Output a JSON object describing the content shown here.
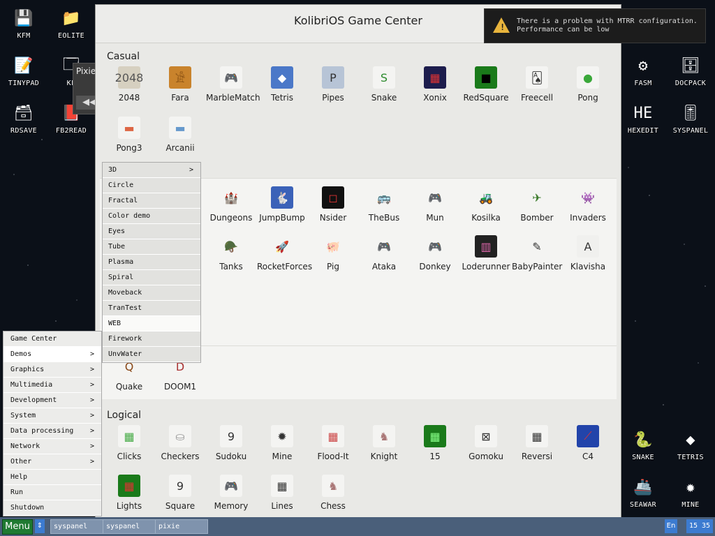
{
  "desktop": {
    "left_icons": [
      {
        "label": "KFM",
        "icon": "floppy-disk-icon",
        "glyph": "💾"
      },
      {
        "label": "EOLITE",
        "icon": "folder-icon",
        "glyph": "📁"
      },
      {
        "label": "TINYPAD",
        "icon": "notepad-icon",
        "glyph": "📝"
      },
      {
        "label": "KF",
        "icon": "app-icon",
        "glyph": "🗔"
      },
      {
        "label": "RDSAVE",
        "icon": "save-icon",
        "glyph": "🗃"
      },
      {
        "label": "FB2READ",
        "icon": "book-icon",
        "glyph": "📕"
      }
    ],
    "right_icons": [
      {
        "label": "FASM",
        "icon": "fasm-icon",
        "glyph": "⚙"
      },
      {
        "label": "DOCPACK",
        "icon": "cabinet-icon",
        "glyph": "🗄"
      },
      {
        "label": "HEXEDIT",
        "icon": "hexedit-icon",
        "glyph": "HE"
      },
      {
        "label": "SYSPANEL",
        "icon": "syspanel-icon",
        "glyph": "🎚"
      },
      {
        "label": "SNAKE",
        "icon": "snake-icon",
        "glyph": "🐍"
      },
      {
        "label": "TETRIS",
        "icon": "tetris-icon",
        "glyph": "◆"
      },
      {
        "label": "SEAWAR",
        "icon": "seawar-icon",
        "glyph": "🚢"
      },
      {
        "label": "MINE",
        "icon": "mine-icon",
        "glyph": "✹"
      }
    ]
  },
  "pixie": {
    "title": "Pixie",
    "button": "◀◀"
  },
  "notification": {
    "line1": "There is a problem with MTRR configuration.",
    "line2": "Performance can be low"
  },
  "window": {
    "title": "KolibriOS Game Center",
    "sections": {
      "casual": "Casual",
      "logical": "Logical"
    },
    "casual_games": [
      {
        "label": "2048",
        "glyph": "2048",
        "bg": "#d6d0c0",
        "fg": "#555"
      },
      {
        "label": "Fara",
        "glyph": "𓀀",
        "bg": "#c9832c",
        "fg": "#5a2c00"
      },
      {
        "label": "MarbleMatch",
        "glyph": "🎮",
        "bg": "#f4f4f2",
        "fg": "#444"
      },
      {
        "label": "Tetris",
        "glyph": "◆",
        "bg": "#4b78c8",
        "fg": "#fff"
      },
      {
        "label": "Pipes",
        "glyph": "P",
        "bg": "#b7c4d6",
        "fg": "#333"
      },
      {
        "label": "Snake",
        "glyph": "S",
        "bg": "#f4f4f2",
        "fg": "#2c8a2c"
      },
      {
        "label": "Xonix",
        "glyph": "▦",
        "bg": "#1d1d4d",
        "fg": "#d33"
      },
      {
        "label": "RedSquare",
        "glyph": "■",
        "bg": "#1a7a1a",
        "fg": "#000"
      },
      {
        "label": "Freecell",
        "glyph": "🂡",
        "bg": "#f4f4f2",
        "fg": "#333"
      },
      {
        "label": "Pong",
        "glyph": "●",
        "bg": "#f4f4f2",
        "fg": "#3aa83a"
      },
      {
        "label": "Pong3",
        "glyph": "▬",
        "bg": "#f4f4f2",
        "fg": "#d64"
      },
      {
        "label": "Arcanii",
        "glyph": "▬",
        "bg": "#f4f4f2",
        "fg": "#69c"
      }
    ],
    "action_games": [
      {
        "label": "Dungeons",
        "glyph": "🏰",
        "bg": "#f4f4f2",
        "fg": "#333"
      },
      {
        "label": "JumpBump",
        "glyph": "🐇",
        "bg": "#3b62b8",
        "fg": "#fff"
      },
      {
        "label": "Nsider",
        "glyph": "◻",
        "bg": "#111",
        "fg": "#d33"
      },
      {
        "label": "TheBus",
        "glyph": "🚌",
        "bg": "#f4f4f2",
        "fg": "#333"
      },
      {
        "label": "Mun",
        "glyph": "🎮",
        "bg": "#f4f4f2",
        "fg": "#444"
      },
      {
        "label": "Kosilka",
        "glyph": "🚜",
        "bg": "#f4f4f2",
        "fg": "#333"
      },
      {
        "label": "Bomber",
        "glyph": "✈",
        "bg": "#f4f4f2",
        "fg": "#3a7a2a"
      },
      {
        "label": "Invaders",
        "glyph": "👾",
        "bg": "#f4f4f2",
        "fg": "#733"
      },
      {
        "label": "Tanks",
        "glyph": "🪖",
        "bg": "#f4f4f2",
        "fg": "#333"
      },
      {
        "label": "RocketForces",
        "glyph": "🚀",
        "bg": "#f4f4f2",
        "fg": "#333"
      },
      {
        "label": "Pig",
        "glyph": "🐖",
        "bg": "#f4f4f2",
        "fg": "#333"
      },
      {
        "label": "Ataka",
        "glyph": "🎮",
        "bg": "#f4f4f2",
        "fg": "#444"
      },
      {
        "label": "Donkey",
        "glyph": "🎮",
        "bg": "#f4f4f2",
        "fg": "#444"
      },
      {
        "label": "Loderunner",
        "glyph": "▥",
        "bg": "#222",
        "fg": "#d6a"
      },
      {
        "label": "BabyPainter",
        "glyph": "✎",
        "bg": "#f4f4f2",
        "fg": "#333"
      },
      {
        "label": "Klavisha",
        "glyph": "A",
        "bg": "#f0f0ee",
        "fg": "#333"
      }
    ],
    "shooter_games": [
      {
        "label": "Quake",
        "glyph": "Q",
        "bg": "#f4f4f2",
        "fg": "#8a4a1a"
      },
      {
        "label": "DOOM1",
        "glyph": "D",
        "bg": "#f4f4f2",
        "fg": "#a33"
      }
    ],
    "logical_games": [
      {
        "label": "Clicks",
        "glyph": "▦",
        "bg": "#f4f4f2",
        "fg": "#4a4"
      },
      {
        "label": "Checkers",
        "glyph": "⛀",
        "bg": "#f4f4f2",
        "fg": "#999"
      },
      {
        "label": "Sudoku",
        "glyph": "9",
        "bg": "#f4f4f2",
        "fg": "#333"
      },
      {
        "label": "Mine",
        "glyph": "✹",
        "bg": "#f4f4f2",
        "fg": "#333"
      },
      {
        "label": "Flood-It",
        "glyph": "▦",
        "bg": "#f4f4f2",
        "fg": "#c44"
      },
      {
        "label": "Knight",
        "glyph": "♞",
        "bg": "#f4f4f2",
        "fg": "#a77"
      },
      {
        "label": "15",
        "glyph": "▦",
        "bg": "#1a7a1a",
        "fg": "#8f8"
      },
      {
        "label": "Gomoku",
        "glyph": "⊠",
        "bg": "#f4f4f2",
        "fg": "#333"
      },
      {
        "label": "Reversi",
        "glyph": "▦",
        "bg": "#f4f4f2",
        "fg": "#333"
      },
      {
        "label": "C4",
        "glyph": "⟋",
        "bg": "#2244aa",
        "fg": "#d33"
      },
      {
        "label": "Lights",
        "glyph": "▦",
        "bg": "#1a7a1a",
        "fg": "#d33"
      },
      {
        "label": "Square",
        "glyph": "9",
        "bg": "#f4f4f2",
        "fg": "#333"
      },
      {
        "label": "Memory",
        "glyph": "🎮",
        "bg": "#f4f4f2",
        "fg": "#444"
      },
      {
        "label": "Lines",
        "glyph": "▦",
        "bg": "#f4f4f2",
        "fg": "#333"
      },
      {
        "label": "Chess",
        "glyph": "♞",
        "bg": "#f4f4f2",
        "fg": "#a77"
      }
    ]
  },
  "start_menu": {
    "items": [
      {
        "label": "Game Center",
        "arrow": ""
      },
      {
        "label": "Demos",
        "arrow": ">"
      },
      {
        "label": "Graphics",
        "arrow": ">"
      },
      {
        "label": "Multimedia",
        "arrow": ">"
      },
      {
        "label": "Development",
        "arrow": ">"
      },
      {
        "label": "System",
        "arrow": ">"
      },
      {
        "label": "Data processing",
        "arrow": ">"
      },
      {
        "label": "Network",
        "arrow": ">"
      },
      {
        "label": "Other",
        "arrow": ">"
      },
      {
        "label": "Help",
        "arrow": ""
      },
      {
        "label": "Run",
        "arrow": ""
      },
      {
        "label": "Shutdown",
        "arrow": ""
      }
    ],
    "submenu": [
      {
        "label": "3D",
        "arrow": ">"
      },
      {
        "label": "Circle",
        "arrow": ""
      },
      {
        "label": "Fractal",
        "arrow": ""
      },
      {
        "label": "Color demo",
        "arrow": ""
      },
      {
        "label": "Eyes",
        "arrow": ""
      },
      {
        "label": "Tube",
        "arrow": ""
      },
      {
        "label": "Plasma",
        "arrow": ""
      },
      {
        "label": "Spiral",
        "arrow": ""
      },
      {
        "label": "Moveback",
        "arrow": ""
      },
      {
        "label": "TranTest",
        "arrow": ""
      },
      {
        "label": "WEB",
        "arrow": ""
      },
      {
        "label": "Firework",
        "arrow": ""
      },
      {
        "label": "UnvWater",
        "arrow": ""
      }
    ]
  },
  "taskbar": {
    "menu_label": "Menu",
    "arrow": "⇕",
    "tasks": [
      "syspanel",
      "syspanel",
      "pixie"
    ],
    "lang": "En",
    "time": "15 35"
  }
}
